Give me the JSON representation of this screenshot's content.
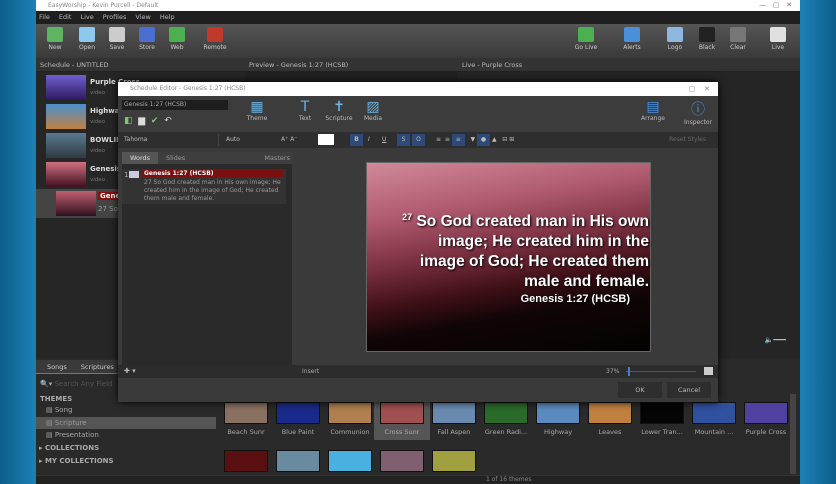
{
  "app": {
    "title": "EasyWorship - Kevin Purcell - Default",
    "menu": [
      "File",
      "Edit",
      "Live",
      "Profiles",
      "View",
      "Help"
    ]
  },
  "toolbar": {
    "left": [
      {
        "label": "New",
        "icon": "new-file-icon",
        "color": "#5fb55f"
      },
      {
        "label": "Open",
        "icon": "folder-icon",
        "color": "#8ec8ef"
      },
      {
        "label": "Save",
        "icon": "save-icon",
        "color": "#ccc"
      },
      {
        "label": "Store",
        "icon": "store-cart-icon",
        "color": "#4a6fd1"
      },
      {
        "label": "Web",
        "icon": "globe-icon",
        "color": "#4caf50"
      },
      {
        "label": "Remote",
        "icon": "remote-icon",
        "color": "#c0392b"
      }
    ],
    "right": [
      {
        "label": "Go Live",
        "icon": "go-live-icon",
        "color": "#4caf50"
      },
      {
        "label": "Alerts",
        "icon": "alerts-icon",
        "color": "#4a90d9"
      },
      {
        "label": "Logo",
        "icon": "logo-icon",
        "color": "#8fb8e0"
      },
      {
        "label": "Black",
        "icon": "black-icon",
        "color": "#222"
      },
      {
        "label": "Clear",
        "icon": "clear-icon",
        "color": "#777"
      },
      {
        "label": "Live",
        "icon": "live-icon",
        "color": "#e0e0e0"
      }
    ]
  },
  "schedule": {
    "header": "Schedule - UNTITLED",
    "items": [
      {
        "title": "Purple Cross",
        "sub": "video"
      },
      {
        "title": "Highway",
        "sub": "video"
      },
      {
        "title": "BOWLING",
        "sub": "video"
      },
      {
        "title": "Genesis 1",
        "sub": "video"
      }
    ],
    "selected": {
      "title": "Genesis",
      "sub": "27 So G"
    }
  },
  "preview": {
    "header": "Preview - Genesis 1:27 (HCSB)"
  },
  "live": {
    "header": "Live - Purple Cross"
  },
  "dialog": {
    "title": "Schedule Editor - Genesis 1:27 (HCSB)",
    "name_value": "Genesis 1:27 (HCSB)",
    "tools": [
      "Theme",
      "Text",
      "Scripture",
      "Media"
    ],
    "right_tools": [
      "Arrange",
      "Inspector"
    ],
    "font": "Tahoma",
    "size": "Auto",
    "reset": "Reset Styles",
    "tabs": [
      "Words",
      "Slides",
      "Masters"
    ],
    "slide_item": {
      "num": "1",
      "title": "Genesis 1:27 (HCSB)",
      "text": "27 So God created man in His own image; He created him in the image of God; He created them male and female."
    },
    "slide": {
      "verse_num": "27",
      "text": "So God created man in His own image; He created him in the image of God; He created them male and female.",
      "ref": "Genesis 1:27 (HCSB)"
    },
    "insert": "Insert",
    "zoom": "37%",
    "zoom_fraction": 0.37,
    "ok": "OK",
    "cancel": "Cancel"
  },
  "library": {
    "tabs": [
      "Songs",
      "Scriptures"
    ],
    "search_placeholder": "Search Any Field",
    "themes_label": "THEMES",
    "themes": [
      "Song",
      "Scripture",
      "Presentation"
    ],
    "collections": "COLLECTIONS",
    "my_collections": "MY COLLECTIONS",
    "thumbs": [
      {
        "name": "Beach Sunr",
        "color": "#8a7060"
      },
      {
        "name": "Blue Paint",
        "color": "#1a2a8a"
      },
      {
        "name": "Communion",
        "color": "#b08050"
      },
      {
        "name": "Cross Sunr",
        "color": "#a05050"
      },
      {
        "name": "Fall Aspen",
        "color": "#6a8ab0"
      },
      {
        "name": "Green Radi...",
        "color": "#2a6a2a"
      },
      {
        "name": "Highway",
        "color": "#5a8ac0"
      },
      {
        "name": "Leaves",
        "color": "#c08040"
      },
      {
        "name": "Lower Tran...",
        "color": "#050505"
      },
      {
        "name": "Mountain ...",
        "color": "#3050a0"
      },
      {
        "name": "Purple Cross",
        "color": "#5040a0"
      }
    ],
    "row2": [
      "#5a1010",
      "#6a8aa0",
      "#4ab0e0",
      "#806070",
      "#a0a040"
    ],
    "count": "1 of 16 themes"
  }
}
